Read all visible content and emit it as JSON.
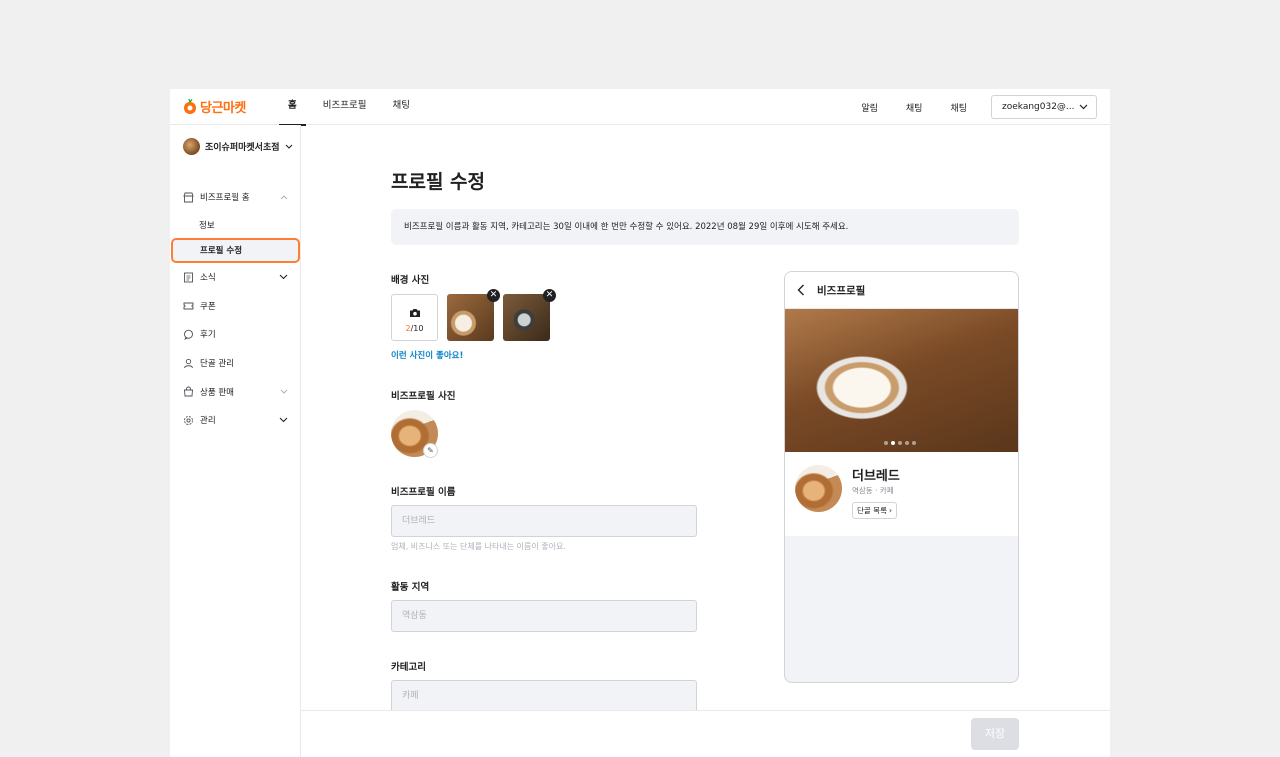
{
  "header": {
    "logo_text": "당근마켓",
    "nav": [
      "홈",
      "비즈프로필",
      "채팅"
    ],
    "right_links": [
      "알림",
      "채팅",
      "채팅"
    ],
    "account": "zoekang032@..."
  },
  "sidebar": {
    "store_name": "조이슈퍼마켓서초점",
    "items": [
      {
        "label": "비즈프로필 홈",
        "icon": "store-icon"
      },
      {
        "label": "정보"
      },
      {
        "label": "프로필 수정"
      },
      {
        "label": "소식",
        "icon": "news-icon"
      },
      {
        "label": "쿠폰",
        "icon": "coupon-icon"
      },
      {
        "label": "후기",
        "icon": "review-icon"
      },
      {
        "label": "단골 관리",
        "icon": "person-icon"
      },
      {
        "label": "상품 판매",
        "icon": "bag-icon"
      },
      {
        "label": "관리",
        "icon": "gear-icon"
      }
    ]
  },
  "main": {
    "title": "프로필 수정",
    "notice": "비즈프로필 이름과 활동 지역, 카테고리는 30일 이내에 한 번만 수정할 수 있어요. 2022년 08월 29일 이후에 시도해 주세요.",
    "bg_photo": {
      "label": "배경 사진",
      "count_current": "2",
      "count_max": "/10",
      "tip": "이런 사진이 좋아요!"
    },
    "profile_photo_label": "비즈프로필 사진",
    "name": {
      "label": "비즈프로필 이름",
      "value": "더브레드",
      "hint": "업체, 비즈니스 또는 단체를 나타내는 이름이 좋아요."
    },
    "region": {
      "label": "활동 지역",
      "value": "역삼동"
    },
    "category": {
      "label": "카테고리",
      "value": "카페"
    },
    "save": "저장"
  },
  "preview": {
    "title": "비즈프로필",
    "name": "더브레드",
    "sub": "역삼동 · 카페",
    "regulars_button": "단골 목록"
  },
  "colors": {
    "brand": "#ff6f0f",
    "link": "#0a84c7",
    "selected_border": "#ff7e36"
  }
}
